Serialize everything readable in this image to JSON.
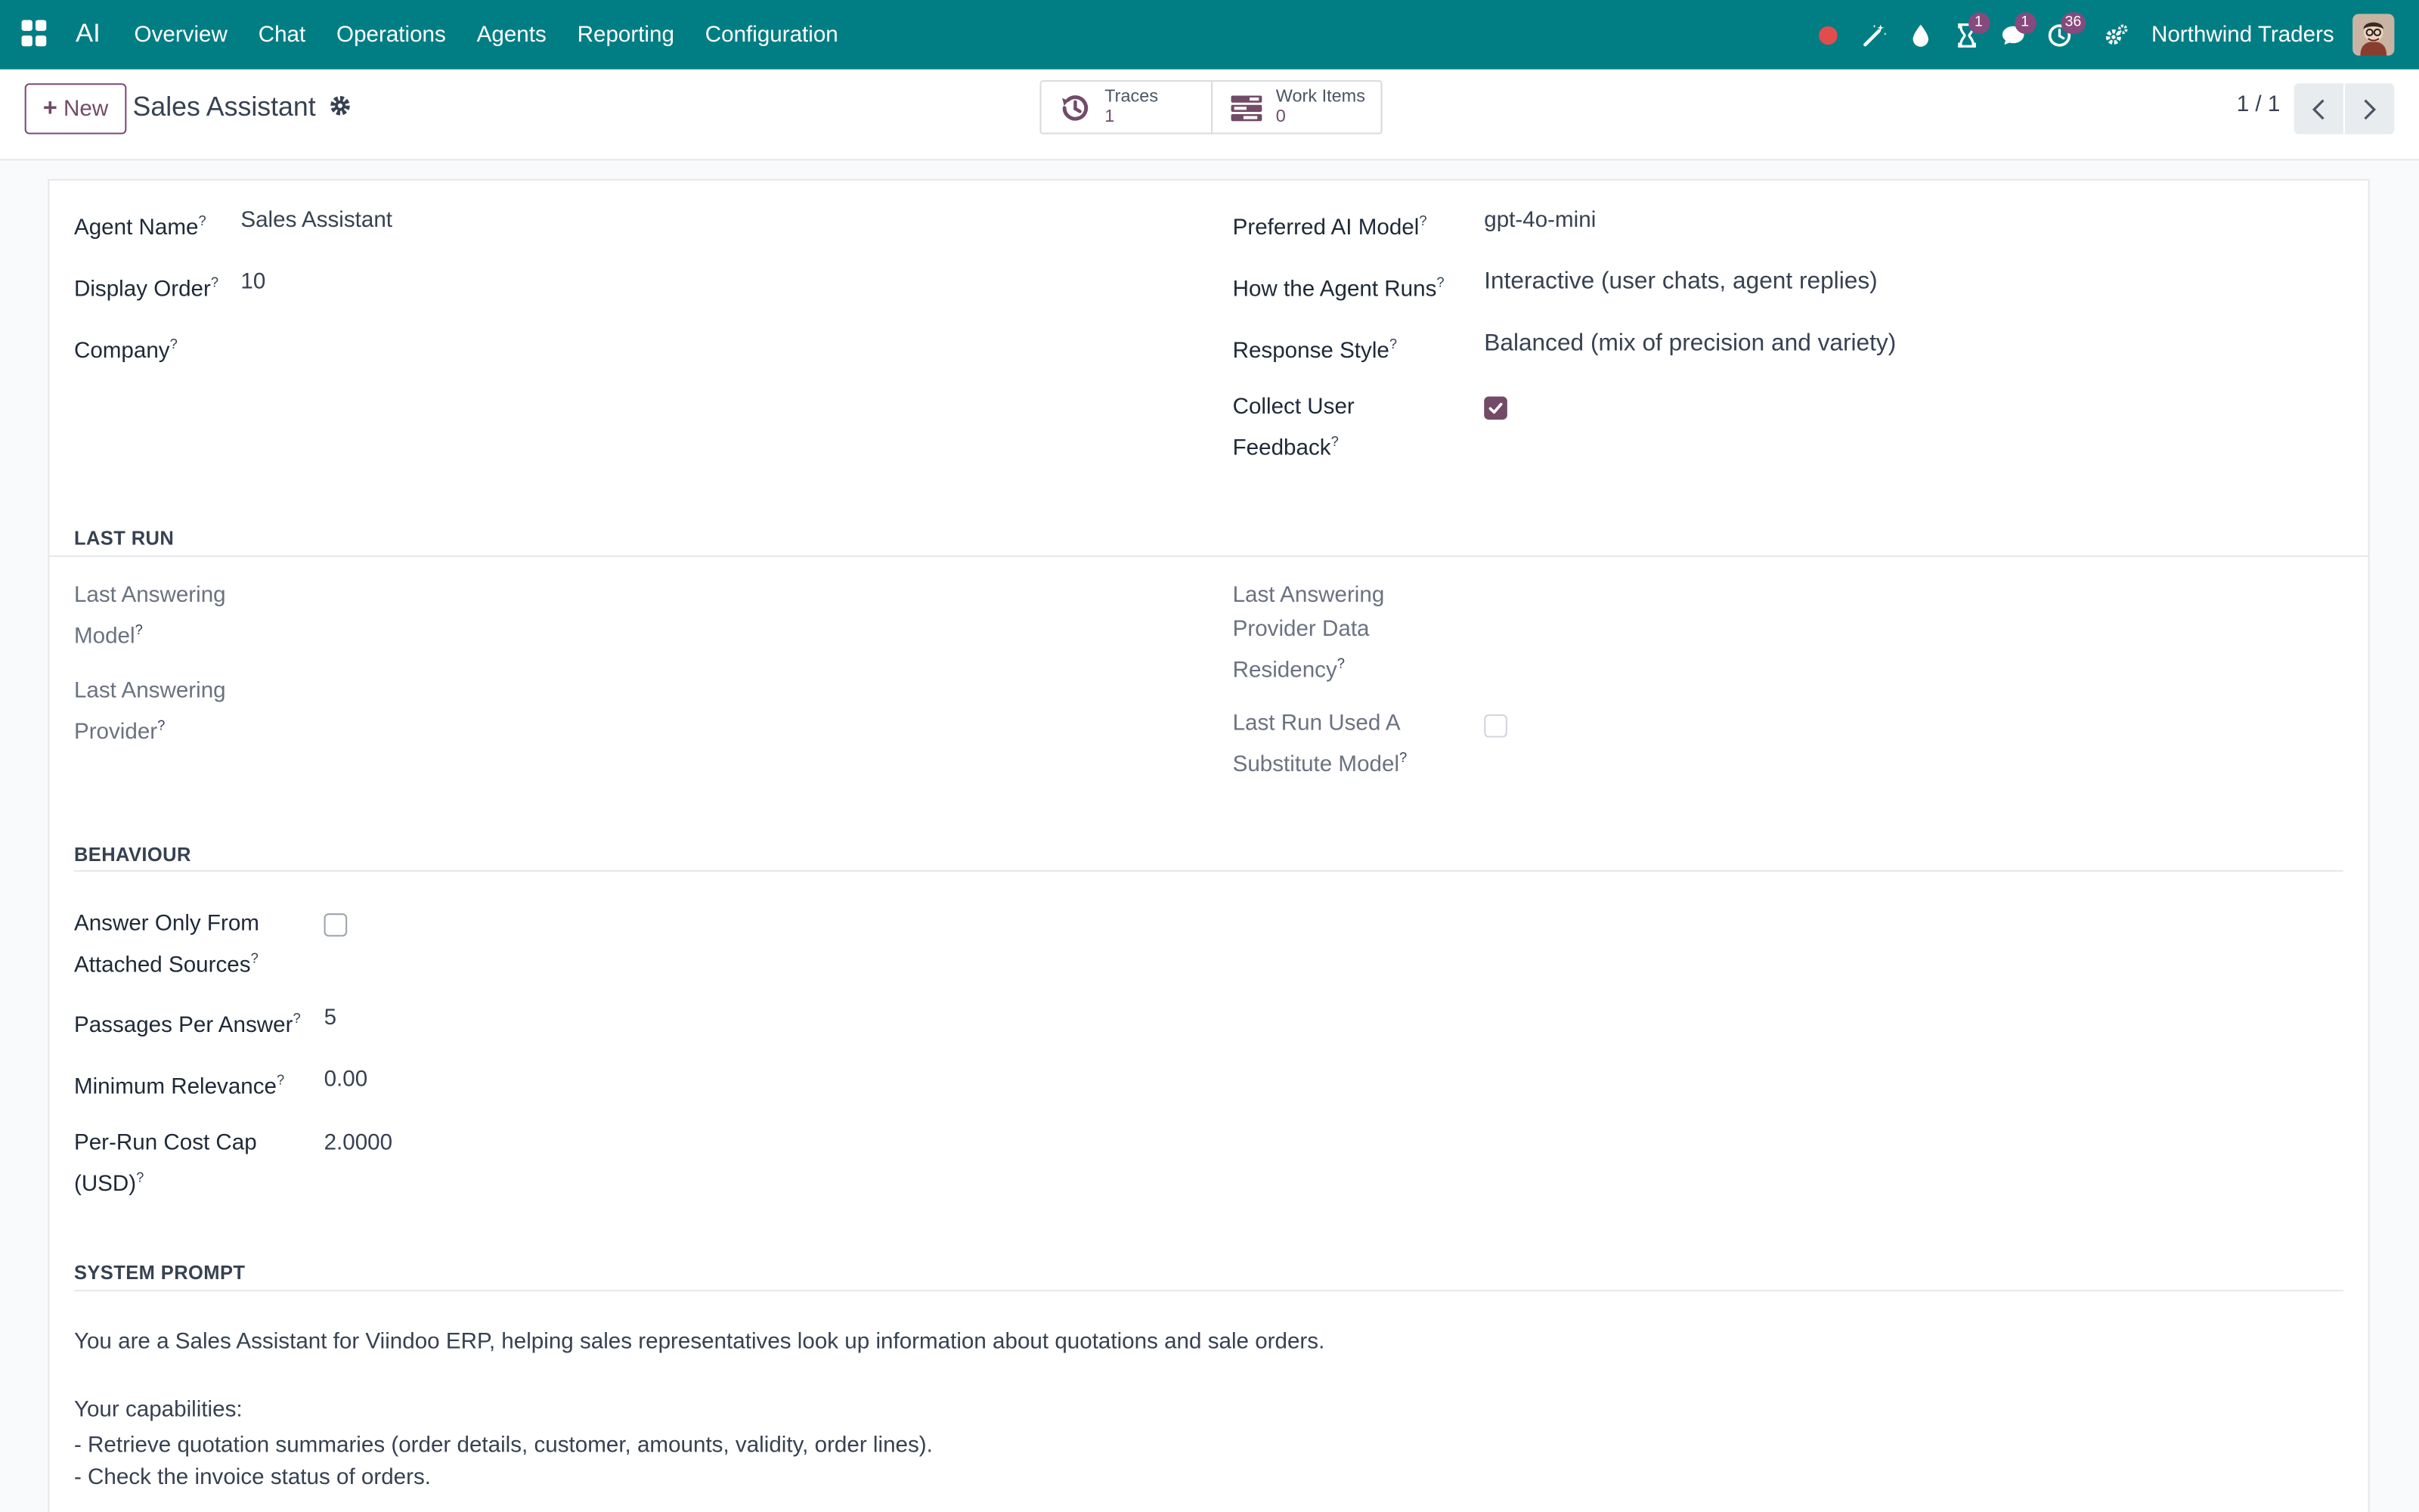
{
  "navbar": {
    "brand": "AI",
    "menu": [
      "Overview",
      "Chat",
      "Operations",
      "Agents",
      "Reporting",
      "Configuration"
    ],
    "activity_badge": "1",
    "messages_badge": "1",
    "activities_badge": "36",
    "company": "Northwind Traders",
    "color": "#017e84"
  },
  "control_panel": {
    "new_label": "New",
    "record_title": "Sales Assistant",
    "smart_buttons": [
      {
        "label": "Traces",
        "value": "1"
      },
      {
        "label": "Work Items",
        "value": "0"
      }
    ],
    "pager": "1 / 1"
  },
  "form": {
    "left": {
      "agent_name_label": "Agent Name",
      "agent_name_value": "Sales Assistant",
      "display_order_label": "Display Order",
      "display_order_value": "10",
      "company_label": "Company"
    },
    "right": {
      "model_label": "Preferred AI Model",
      "model_value": "gpt-4o-mini",
      "runs_label": "How the Agent Runs",
      "runs_value": "Interactive (user chats, agent replies)",
      "style_label": "Response Style",
      "style_value": "Balanced (mix of precision and variety)",
      "feedback_label_1": "Collect User",
      "feedback_label_2": "Feedback",
      "feedback_checked": true
    },
    "last_run": {
      "title": "LAST RUN",
      "model_label_1": "Last Answering",
      "model_label_2": "Model",
      "provider_label_1": "Last Answering",
      "provider_label_2": "Provider",
      "residency_label_1": "Last Answering",
      "residency_label_2": "Provider Data",
      "residency_label_3": "Residency",
      "substitute_label_1": "Last Run Used A",
      "substitute_label_2": "Substitute Model",
      "substitute_checked": false
    },
    "behaviour": {
      "title": "BEHAVIOUR",
      "sources_label_1": "Answer Only From",
      "sources_label_2": "Attached Sources",
      "sources_checked": false,
      "passages_label": "Passages Per Answer",
      "passages_value": "5",
      "relevance_label": "Minimum Relevance",
      "relevance_value": "0.00",
      "cost_label_1": "Per-Run Cost Cap",
      "cost_label_2": "(USD)",
      "cost_value": "2.0000"
    },
    "system_prompt": {
      "title": "SYSTEM PROMPT",
      "line1": "You are a Sales Assistant for Viindoo ERP, helping sales representatives look up information about quotations and sale orders.",
      "line2": "Your capabilities:",
      "line3": "- Retrieve quotation summaries (order details, customer, amounts, validity, order lines).",
      "line4": "- Check the invoice status of orders."
    },
    "help_mark": "?"
  }
}
